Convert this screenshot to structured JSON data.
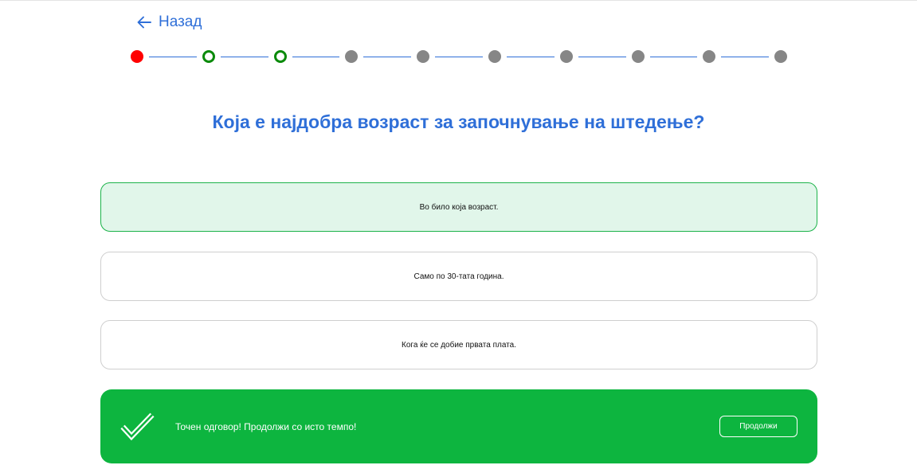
{
  "nav": {
    "back_label": "Назад",
    "back_icon": "arrow-left-icon"
  },
  "progress": {
    "total_steps": 10,
    "current_step": 3,
    "steps": [
      "wrong",
      "correct",
      "correct",
      "pending",
      "pending",
      "pending",
      "pending",
      "pending",
      "pending",
      "pending"
    ]
  },
  "quiz": {
    "question": "Која е најдобра возраст за започнување на штедење?",
    "answers": [
      {
        "label": "Во било која возраст.",
        "selected": true
      },
      {
        "label": "Само по 30-тата година.",
        "selected": false
      },
      {
        "label": "Кога ќе се добие првата плата.",
        "selected": false
      }
    ]
  },
  "feedback": {
    "message": "Точен одговор! Продолжи со исто темпо!",
    "continue_label": "Продолжи",
    "icon": "checkmark-icon"
  },
  "colors": {
    "accent_blue": "#2f6fd8",
    "wrong_red": "#ff0000",
    "correct_green": "#0a8a0a",
    "pending_gray": "#868686",
    "success_banner": "#0db53f",
    "selected_bg": "#e1f6ea",
    "selected_border": "#1cb34a"
  }
}
